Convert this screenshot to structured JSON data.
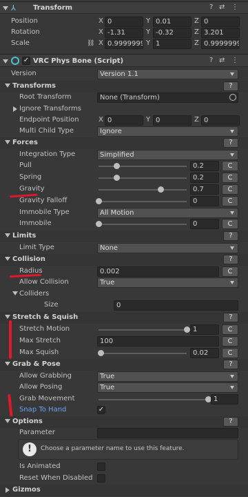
{
  "transform": {
    "title": "Transform",
    "rows": [
      {
        "label": "Position",
        "x": "0",
        "y": "0.01",
        "z": "0"
      },
      {
        "label": "Rotation",
        "x": "-1.31",
        "y": "-0.32",
        "z": "3.201"
      },
      {
        "label": "Scale",
        "x": "0.9999999",
        "y": "1",
        "z": "0.9999999"
      }
    ]
  },
  "axes": {
    "x": "X",
    "y": "Y",
    "z": "Z"
  },
  "component": {
    "title": "VRC Phys Bone (Script)",
    "version_label": "Version",
    "version_value": "Version 1.1"
  },
  "header_icons": {
    "help": "?",
    "settings": "⇄",
    "more": "⋮"
  },
  "help_button": "?",
  "c_button": "C",
  "transforms": {
    "title": "Transforms",
    "root_label": "Root Transform",
    "root_value": "None (Transform)",
    "ignore_label": "Ignore Transforms",
    "endpoint_label": "Endpoint Position",
    "endpoint": {
      "x": "0",
      "y": "0",
      "z": "0"
    },
    "multi_label": "Multi Child Type",
    "multi_value": "Ignore"
  },
  "forces": {
    "title": "Forces",
    "integration_label": "Integration Type",
    "integration_value": "Simplified",
    "pull_label": "Pull",
    "pull_value": "0.2",
    "pull_level": 0.2,
    "spring_label": "Spring",
    "spring_value": "0.2",
    "spring_level": 0.2,
    "gravity_label": "Gravity",
    "gravity_value": "0.7",
    "gravity_level": 0.7,
    "falloff_label": "Gravity Falloff",
    "falloff_value": "0",
    "falloff_level": 0,
    "immobile_type_label": "Immobile Type",
    "immobile_type_value": "All Motion",
    "immobile_label": "Immobile",
    "immobile_value": "0",
    "immobile_level": 0
  },
  "limits": {
    "title": "Limits",
    "type_label": "Limit Type",
    "type_value": "None"
  },
  "collision": {
    "title": "Collision",
    "radius_label": "Radius",
    "radius_value": "0.002",
    "allow_label": "Allow Collision",
    "allow_value": "True",
    "colliders_label": "Colliders",
    "size_label": "Size",
    "size_value": "0"
  },
  "stretch": {
    "title": "Stretch & Squish",
    "motion_label": "Stretch Motion",
    "motion_value": "1",
    "motion_level": 1,
    "max_stretch_label": "Max Stretch",
    "max_stretch_value": "100",
    "max_squish_label": "Max Squish",
    "max_squish_value": "0.02",
    "max_squish_level": 0.02
  },
  "grab": {
    "title": "Grab & Pose",
    "allow_grab_label": "Allow Grabbing",
    "allow_grab_value": "True",
    "allow_pose_label": "Allow Posing",
    "allow_pose_value": "True",
    "movement_label": "Grab Movement",
    "movement_value": "1",
    "movement_level": 1,
    "snap_label": "Snap To Hand",
    "snap_checked": "✓"
  },
  "options": {
    "title": "Options",
    "parameter_label": "Parameter",
    "help_text": "Choose a parameter name to use this feature.",
    "animated_label": "Is Animated",
    "reset_label": "Reset When Disabled"
  },
  "gizmos": {
    "title": "Gizmos"
  },
  "colors": {
    "annotation_red": "#e0182b",
    "link_blue": "#6aa2f5",
    "header_bg": "#3e3e3e"
  }
}
